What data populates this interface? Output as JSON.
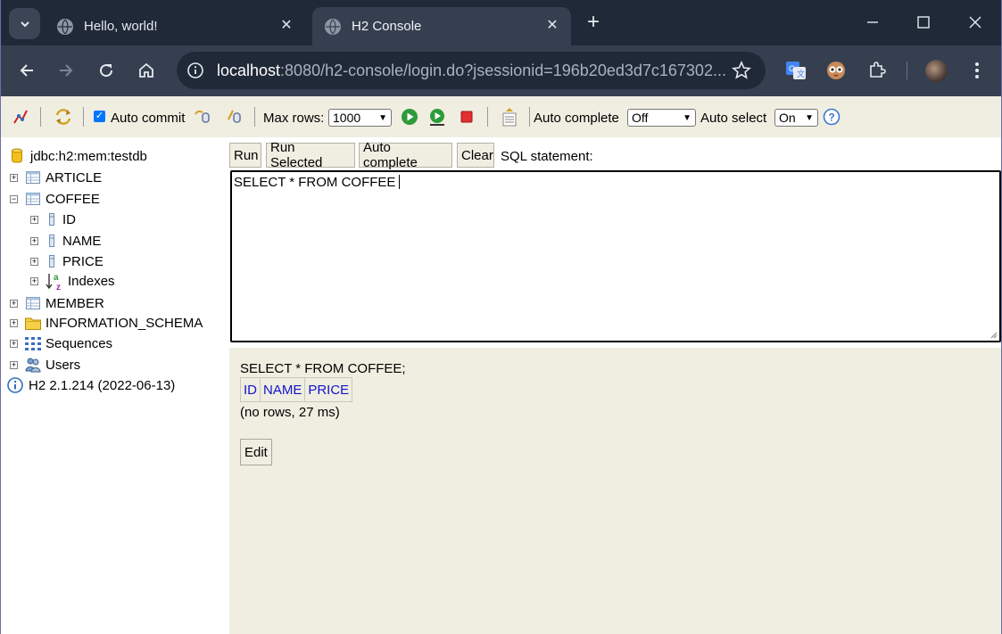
{
  "browser": {
    "tabs": [
      {
        "title": "Hello, world!"
      },
      {
        "title": "H2 Console"
      }
    ],
    "url_host": "localhost",
    "url_rest": ":8080/h2-console/login.do?jsessionid=196b20ed3d7c167302..."
  },
  "toolbar": {
    "auto_commit_label": "Auto commit",
    "max_rows_label": "Max rows:",
    "max_rows_value": "1000",
    "auto_complete_label": "Auto complete",
    "auto_complete_value": "Off",
    "auto_select_label": "Auto select",
    "auto_select_value": "On"
  },
  "tree": {
    "connection": "jdbc:h2:mem:testdb",
    "article": "ARTICLE",
    "coffee": "COFFEE",
    "col_id": "ID",
    "col_name": "NAME",
    "col_price": "PRICE",
    "indexes": "Indexes",
    "member": "MEMBER",
    "information_schema": "INFORMATION_SCHEMA",
    "sequences": "Sequences",
    "users": "Users",
    "version": "H2 2.1.214 (2022-06-13)"
  },
  "sql": {
    "run": "Run",
    "run_selected": "Run Selected",
    "auto_complete": "Auto complete",
    "clear": "Clear",
    "statement_label": "SQL statement:",
    "text": "SELECT * FROM COFFEE"
  },
  "result": {
    "query": "SELECT * FROM COFFEE;",
    "columns": [
      "ID",
      "NAME",
      "PRICE"
    ],
    "status": "(no rows, 27 ms)",
    "edit": "Edit"
  }
}
